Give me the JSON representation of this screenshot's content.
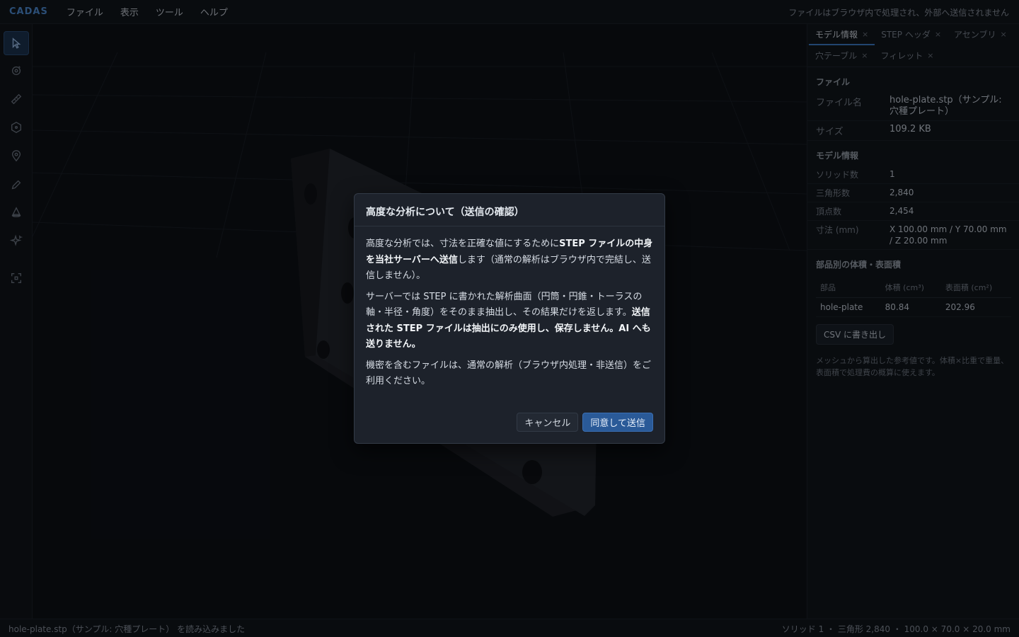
{
  "menubar": {
    "logo": "CADAS",
    "items": [
      "ファイル",
      "表示",
      "ツール",
      "ヘルプ"
    ],
    "privacy_note": "ファイルはブラウザ内で処理され、外部へ送信されません"
  },
  "toolbar": {
    "tools": [
      "select-icon",
      "orbit-target-icon",
      "measure-ruler-icon",
      "hexagon-icon",
      "location-pin-icon",
      "pencil-icon",
      "cone-icon",
      "sparkle-icon",
      "frame-focus-icon"
    ]
  },
  "panel": {
    "tabs": [
      {
        "label": "モデル情報",
        "close": "×"
      },
      {
        "label": "STEP ヘッダ",
        "close": "×"
      },
      {
        "label": "アセンブリ",
        "close": "×"
      },
      {
        "label": "穴テーブル",
        "close": "×"
      },
      {
        "label": "フィレット",
        "close": "×"
      }
    ],
    "file": {
      "section": "ファイル",
      "name_label": "ファイル名",
      "name_value": "hole-plate.stp（サンプル: 穴種プレート）",
      "size_label": "サイズ",
      "size_value": "109.2 KB"
    },
    "model": {
      "section": "モデル情報",
      "solids_label": "ソリッド数",
      "solids_value": "1",
      "triangles_label": "三角形数",
      "triangles_value": "2,840",
      "vertices_label": "頂点数",
      "vertices_value": "2,454",
      "dims_label": "寸法 (mm)",
      "dims_value": "X 100.00 mm / Y 70.00 mm / Z 20.00 mm"
    },
    "parts": {
      "section": "部品別の体積・表面積",
      "headers": [
        "部品",
        "体積 (cm³)",
        "表面積 (cm²)"
      ],
      "rows": [
        [
          "hole-plate",
          "80.84",
          "202.96"
        ]
      ]
    },
    "csv_button": "CSV に書き出し",
    "note": "メッシュから算出した参考値です。体積×比重で重量、表面積で処理費の概算に使えます。"
  },
  "status": {
    "left": "hole-plate.stp（サンプル: 穴種プレート） を読み込みました",
    "right": "ソリッド 1 ・ 三角形 2,840 ・ 100.0 × 70.0 × 20.0 mm"
  },
  "modal": {
    "title": "高度な分析について（送信の確認）",
    "p1_a": "高度な分析では、寸法を正確な値にするために",
    "p1_b": "STEP ファイルの中身を当社サーバーへ送信",
    "p1_c": "します（通常の解析はブラウザ内で完結し、送信しません）。",
    "p2_a": "サーバーでは STEP に書かれた解析曲面（円筒・円錐・トーラスの軸・半径・角度）をそのまま抽出し、その結果だけを返します。",
    "p2_b": "送信された STEP ファイルは抽出にのみ使用し、保存しません。AI へも送りません。",
    "p3": "機密を含むファイルは、通常の解析（ブラウザ内処理・非送信）をご利用ください。",
    "cancel": "キャンセル",
    "confirm": "同意して送信"
  }
}
